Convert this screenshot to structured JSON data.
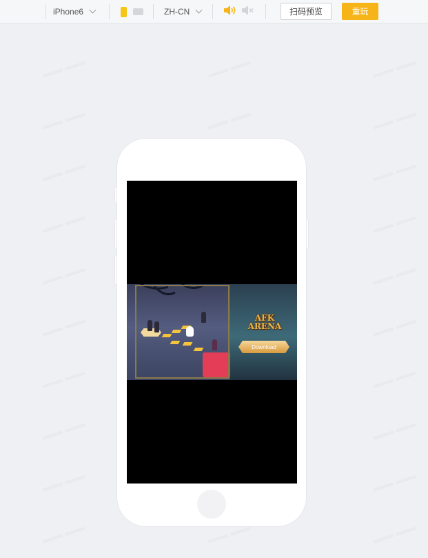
{
  "toolbar": {
    "device": "iPhone6",
    "language": "ZH-CN",
    "scan_preview_label": "扫码预览",
    "replay_label": "重玩",
    "accent_color": "#f7b418"
  },
  "ad": {
    "logo_line1": "AFK",
    "logo_line2": "ARENA",
    "download_label": "Download"
  },
  "icons": {
    "sound_on": "speaker-icon",
    "sound_off": "mute-icon",
    "device_chevron": "chevron-down-icon",
    "language_chevron": "chevron-down-icon",
    "hand": "hand-pointer-icon"
  }
}
